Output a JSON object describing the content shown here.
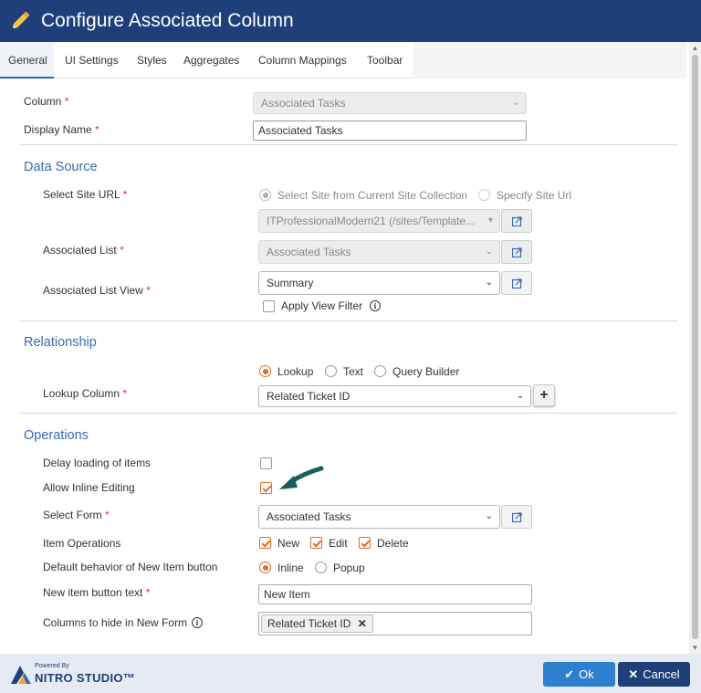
{
  "window": {
    "title": "Configure Associated Column"
  },
  "tabs": [
    "General",
    "UI Settings",
    "Styles",
    "Aggregates",
    "Column Mappings",
    "Toolbar"
  ],
  "general": {
    "column_label": "Column",
    "column_value": "Associated Tasks",
    "display_name_label": "Display Name",
    "display_name_value": "Associated Tasks",
    "required_mark": "*"
  },
  "data_source": {
    "heading": "Data Source",
    "site_url_label": "Select Site URL",
    "site_option_current": "Select Site from Current Site Collection",
    "site_option_specify": "Specify Site Url",
    "site_value": "ITProfessionalModern21 (/sites/Template...",
    "associated_list_label": "Associated List",
    "associated_list_value": "Associated Tasks",
    "list_view_label": "Associated List View",
    "list_view_value": "Summary",
    "apply_view_filter_label": "Apply View Filter"
  },
  "relationship": {
    "heading": "Relationship",
    "option_lookup": "Lookup",
    "option_text": "Text",
    "option_query_builder": "Query Builder",
    "lookup_column_label": "Lookup Column",
    "lookup_column_value": "Related Ticket ID",
    "add_symbol": "+"
  },
  "operations": {
    "heading": "Operations",
    "delay_loading_label": "Delay loading of items",
    "allow_inline_label": "Allow Inline Editing",
    "select_form_label": "Select Form",
    "select_form_value": "Associated Tasks",
    "item_operations_label": "Item Operations",
    "op_new": "New",
    "op_edit": "Edit",
    "op_delete": "Delete",
    "default_behavior_label": "Default behavior of New Item button",
    "behavior_inline": "Inline",
    "behavior_popup": "Popup",
    "new_item_text_label": "New item button text",
    "new_item_text_value": "New Item",
    "columns_hide_label": "Columns to hide in New Form",
    "columns_hide_chip": "Related Ticket ID"
  },
  "footer": {
    "powered_by": "Powered By",
    "brand": "NITRO STUDIO™",
    "ok_label": "Ok",
    "cancel_label": "Cancel"
  },
  "colors": {
    "header": "#1e3f7a",
    "accent_orange": "#e06c2a",
    "section_blue": "#3a6bb0",
    "ok_button": "#2f7fd0",
    "arrow_teal": "#1d5c5c"
  }
}
